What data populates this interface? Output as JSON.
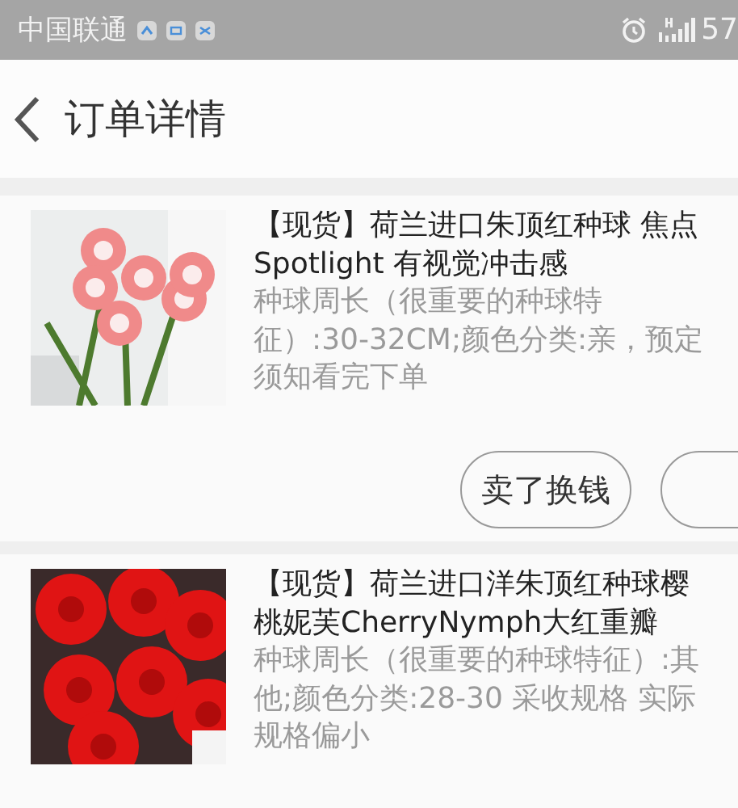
{
  "status_bar": {
    "carrier": "中国联通",
    "battery": "57"
  },
  "header": {
    "title": "订单详情"
  },
  "orders": [
    {
      "title": "【现货】荷兰进口朱顶红种球 焦点 Spotlight 有视觉冲击感",
      "spec": "种球周长（很重要的种球特征）:30-32CM;颜色分类:亲，预定须知看完下单",
      "actions": [
        {
          "kind": "labeled",
          "label": "卖了换钱"
        },
        {
          "kind": "cut"
        }
      ]
    },
    {
      "title": "【现货】荷兰进口洋朱顶红种球樱桃妮芙CherryNymph大红重瓣",
      "spec": "种球周长（很重要的种球特征）:其他;颜色分类:28-30 采收规格 实际规格偏小"
    }
  ]
}
